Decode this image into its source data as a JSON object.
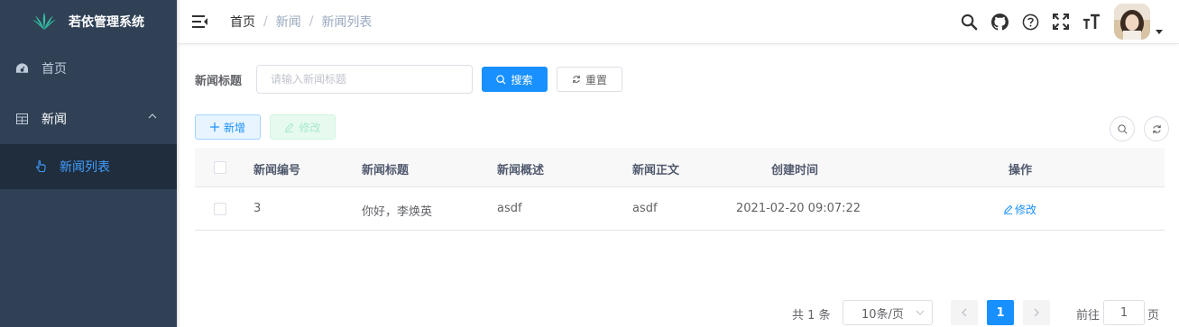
{
  "sidebar": {
    "app_title": "若依管理系统",
    "items": [
      {
        "label": "首页"
      },
      {
        "label": "新闻"
      }
    ],
    "sub_items": [
      {
        "label": "新闻列表"
      }
    ],
    "bg_color": "#304156",
    "active_color": "#409eff"
  },
  "navbar": {
    "breadcrumb": [
      "首页",
      "新闻",
      "新闻列表"
    ],
    "breadcrumb_separator": "/",
    "icons": [
      "search-icon",
      "github-icon",
      "question-icon",
      "fullscreen-icon",
      "font-size-icon"
    ]
  },
  "search": {
    "label": "新闻标题",
    "placeholder": "请输入新闻标题",
    "search_button": "搜索",
    "reset_button": "重置"
  },
  "toolbar": {
    "add_button": "新增",
    "edit_button": "修改"
  },
  "table": {
    "columns": [
      "新闻编号",
      "新闻标题",
      "新闻概述",
      "新闻正文",
      "创建时间",
      "操作"
    ],
    "rows": [
      {
        "id": "3",
        "title": "你好，李焕英",
        "summary": "asdf",
        "content": "asdf",
        "created": "2021-02-20 09:07:22",
        "action": "修改"
      }
    ]
  },
  "pagination": {
    "total_text": "共 1 条",
    "page_size": "10条/页",
    "current_page": "1",
    "goto_label": "前往",
    "goto_value": "1",
    "page_suffix": "页"
  },
  "colors": {
    "primary": "#1890ff",
    "success_light": "#e7faf0"
  }
}
